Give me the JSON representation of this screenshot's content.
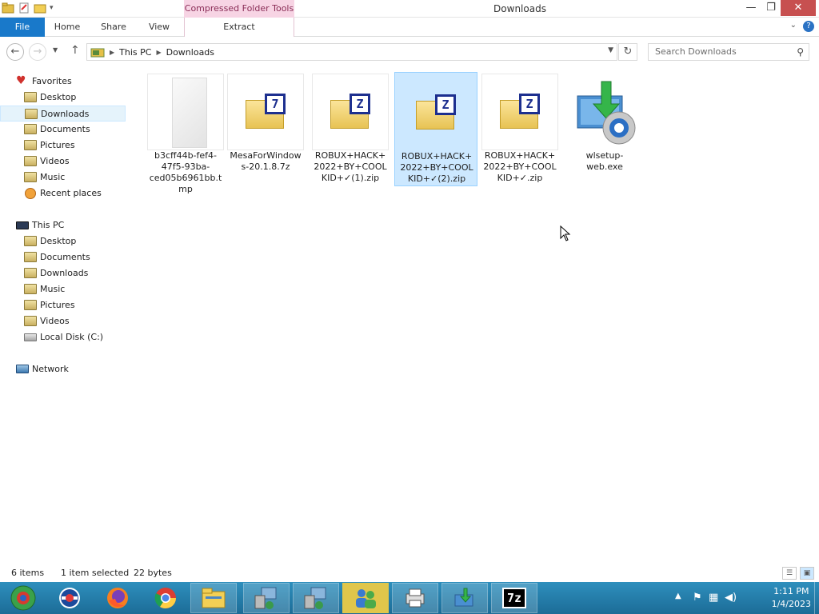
{
  "window": {
    "title": "Downloads",
    "context_tab_group": "Compressed Folder Tools",
    "minimize": "—",
    "maximize": "❐",
    "close": "✕"
  },
  "ribbon": {
    "tabs": [
      "File",
      "Home",
      "Share",
      "View",
      "Extract"
    ],
    "help": "?",
    "collapse": "⌄"
  },
  "address": {
    "crumbs": [
      "This PC",
      "Downloads"
    ],
    "search_placeholder": "Search Downloads"
  },
  "nav": {
    "favorites": {
      "header": "Favorites",
      "items": [
        "Desktop",
        "Downloads",
        "Documents",
        "Pictures",
        "Videos",
        "Music",
        "Recent places"
      ]
    },
    "this_pc": {
      "header": "This PC",
      "items": [
        "Desktop",
        "Documents",
        "Downloads",
        "Music",
        "Pictures",
        "Videos",
        "Local Disk (C:)"
      ]
    },
    "network": "Network"
  },
  "files": [
    {
      "name": "b3cff44b-fef4-47f5-93ba-ced05b6961bb.tmp",
      "icon": "blank-document-icon"
    },
    {
      "name": "MesaForWindows-20.1.8.7z",
      "icon": "7z-archive-icon",
      "badge": "7"
    },
    {
      "name": "ROBUX+HACK+2022+BY+COOLKID+✓(1).zip",
      "icon": "zip-archive-icon",
      "badge": "Z"
    },
    {
      "name": "ROBUX+HACK+2022+BY+COOLKID+✓(2).zip",
      "icon": "zip-archive-icon",
      "badge": "Z",
      "selected": true
    },
    {
      "name": "ROBUX+HACK+2022+BY+COOLKID+✓.zip",
      "icon": "zip-archive-icon",
      "badge": "Z"
    },
    {
      "name": "wlsetup-web.exe",
      "icon": "installer-icon"
    }
  ],
  "status": {
    "count": "6 items",
    "selection": "1 item selected",
    "size": "22 bytes"
  },
  "taskbar": {
    "apps": [
      "system-monitor-icon",
      "internet-explorer-icon",
      "firefox-icon",
      "chrome-icon",
      "file-explorer-icon",
      "network-setup-icon",
      "network-setup-2-icon",
      "users-icon",
      "printer-icon",
      "installer-icon",
      "7zip-icon"
    ],
    "sevenzip_label": "7z",
    "clock_time": "1:11 PM",
    "clock_date": "1/4/2023"
  },
  "colors": {
    "file_tab": "#1979ca",
    "selection": "#cce8ff",
    "taskbar": "#2380b0",
    "context_tab": "#f7d4e4"
  }
}
